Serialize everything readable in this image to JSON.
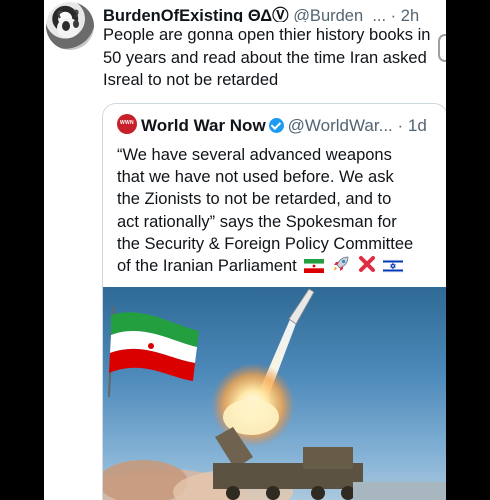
{
  "tweet": {
    "display_name": "BurdenOfExisting ΘΔⓋ",
    "handle": "@Burden_...",
    "separator": "·",
    "time": "2h",
    "lines": [
      "People are gonna open thier history books in",
      "50 years and read about the time Iran asked",
      "Isreal to not be retarded"
    ]
  },
  "quoted": {
    "avatar_text": "WWN",
    "display_name": "World War Now",
    "handle": "@WorldWar...",
    "separator": "·",
    "time": "1d",
    "lines": [
      "“We have several advanced weapons",
      "that we have not used before. We ask",
      "the Zionists to not be retarded, and to",
      "act rationally” says the Spokesman for",
      "the Security & Foreign Policy Committee",
      "of the Iranian Parliament"
    ],
    "emojis": [
      "iran-flag-icon",
      "rocket-icon",
      "cross-mark-icon",
      "israel-flag-icon"
    ]
  },
  "colors": {
    "background": "#000000",
    "text": "#0f1419",
    "secondary_text": "#536471",
    "border": "#cfd9de",
    "verified": "#1d9bf0"
  }
}
